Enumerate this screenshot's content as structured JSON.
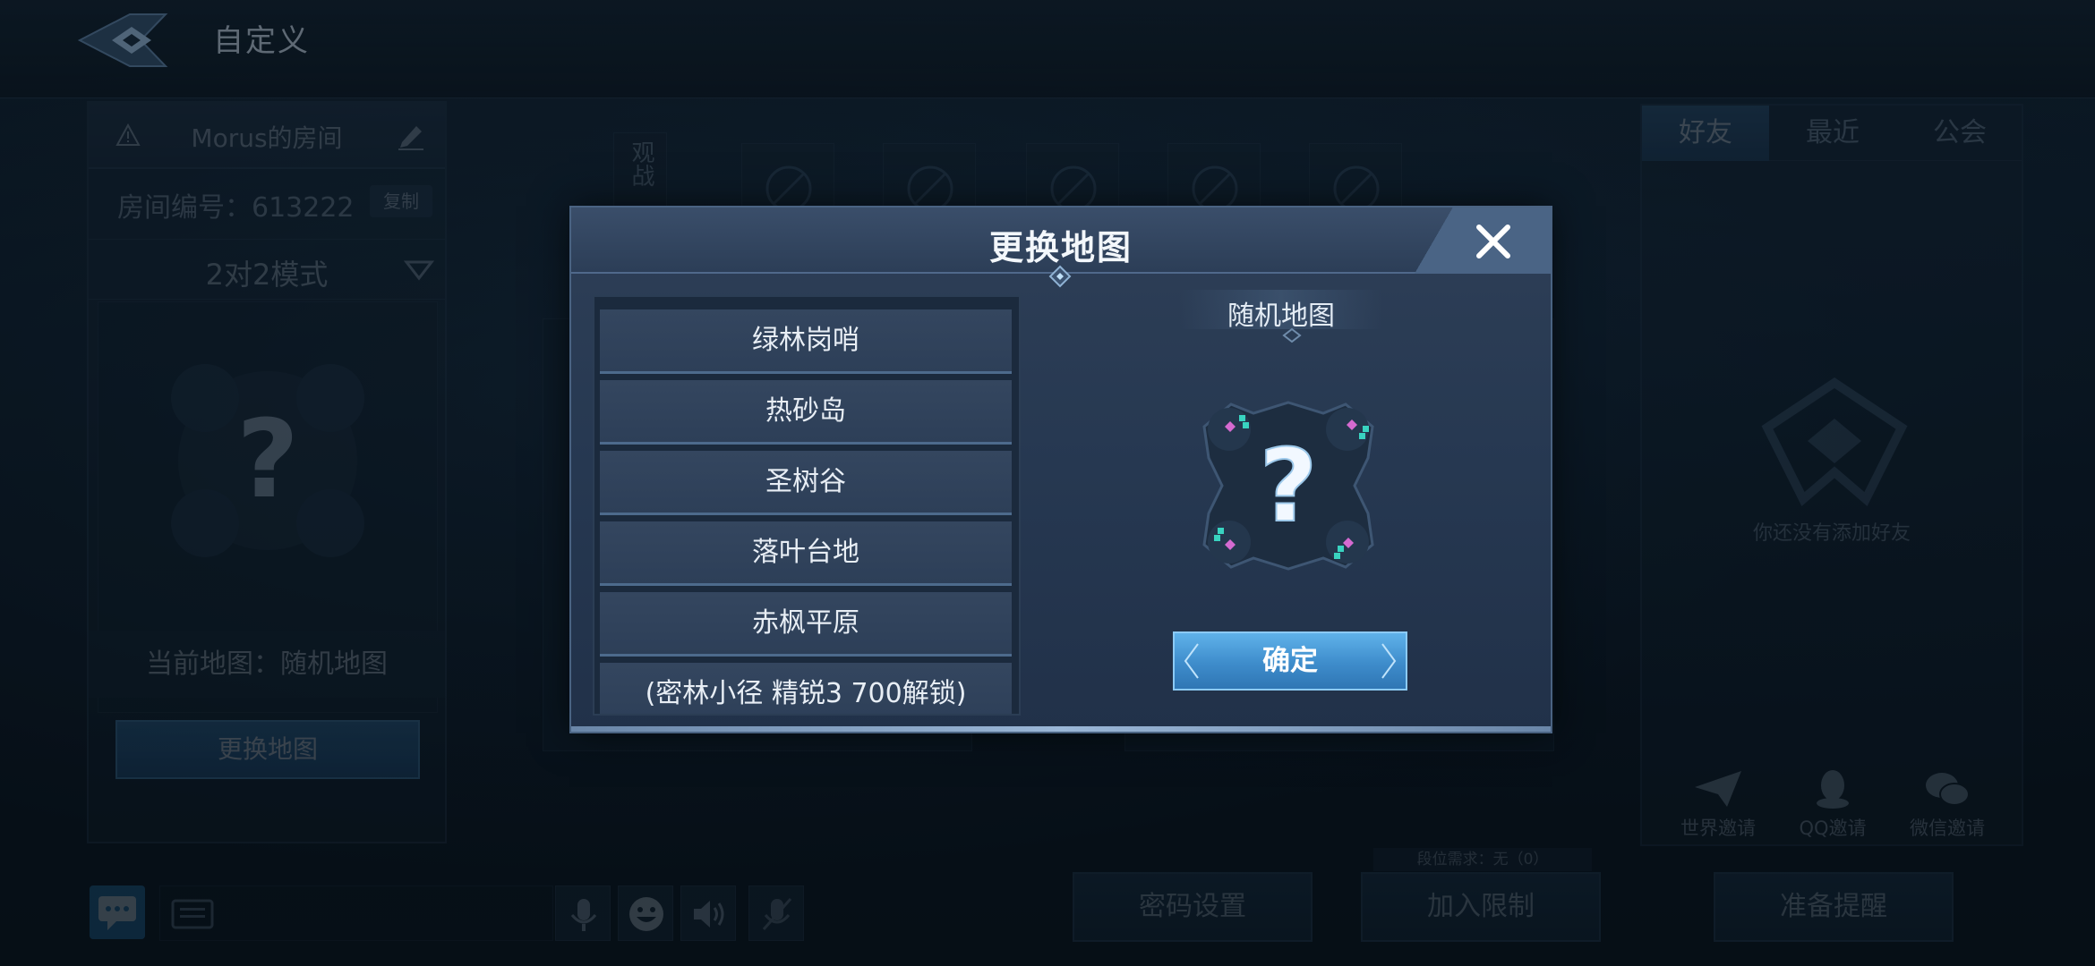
{
  "header": {
    "title": "自定义"
  },
  "room": {
    "name": "Morus的房间",
    "id_text": "房间编号：613222",
    "copy_label": "复制",
    "mode": "2对2模式",
    "current_map": "当前地图：随机地图",
    "change_map_label": "更换地图"
  },
  "center": {
    "spectate_label": "观战"
  },
  "friends": {
    "tabs": [
      "好友",
      "最近",
      "公会"
    ],
    "empty_text": "你还没有添加好友",
    "invites": [
      "世界邀请",
      "QQ邀请",
      "微信邀请"
    ]
  },
  "bottom": {
    "rank_requirement": "段位需求：无（0）",
    "buttons": [
      "密码设置",
      "加入限制",
      "准备提醒"
    ]
  },
  "modal": {
    "title": "更换地图",
    "maps": [
      "绿林岗哨",
      "热砂岛",
      "圣树谷",
      "落叶台地",
      "赤枫平原",
      "(密林小径  精锐3 700解锁)"
    ],
    "selected_map": "随机地图",
    "confirm_label": "确定"
  },
  "colors": {
    "accent": "#3e8ccb",
    "modal_bg": "#263851",
    "map_item_bg": "#34465f",
    "friend_tab_active": "#3a6a95",
    "chat_button": "#2d80bf"
  },
  "icons": [
    "back-icon",
    "warning-icon",
    "edit-icon",
    "dropdown-arrow-icon",
    "slot-lock-icon",
    "friends-logo-icon",
    "paper-plane-icon",
    "qq-icon",
    "wechat-icon",
    "chat-icon",
    "keyboard-icon",
    "mic-icon",
    "emoji-icon",
    "speaker-icon",
    "mute-mic-icon",
    "close-icon"
  ]
}
